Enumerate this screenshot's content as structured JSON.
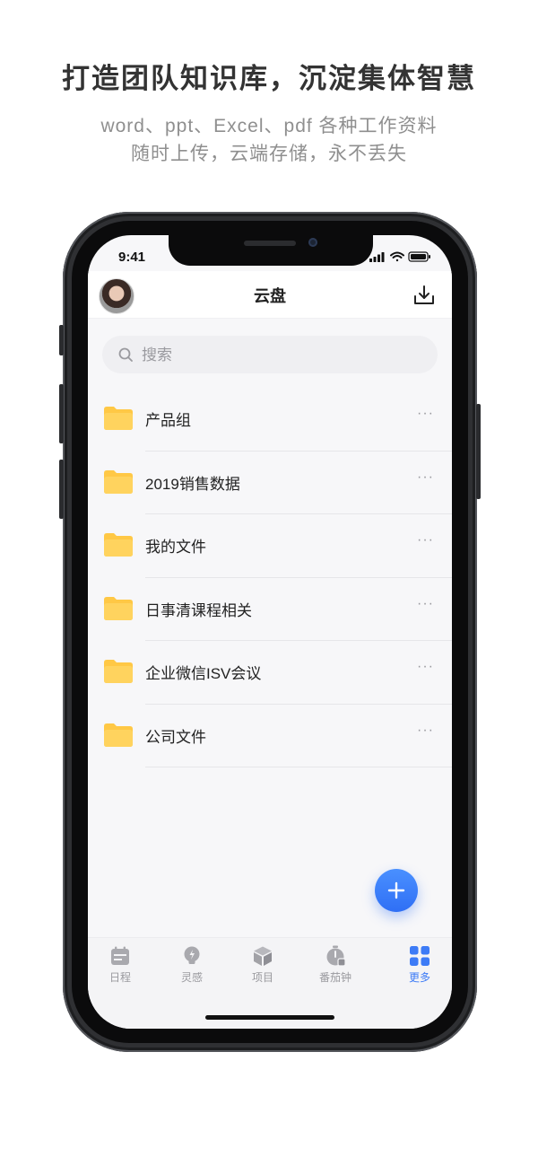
{
  "promo": {
    "headline": "打造团队知识库，沉淀集体智慧",
    "subline1": "word、ppt、Excel、pdf 各种工作资料",
    "subline2": "随时上传，云端存储，永不丢失"
  },
  "status_bar": {
    "time": "9:41"
  },
  "header": {
    "title": "云盘"
  },
  "search": {
    "placeholder": "搜索"
  },
  "folders": [
    {
      "name": "产品组",
      "more": "···"
    },
    {
      "name": "2019销售数据",
      "more": "···"
    },
    {
      "name": "我的文件",
      "more": "···"
    },
    {
      "name": "日事清课程相关",
      "more": "···"
    },
    {
      "name": "企业微信ISV会议",
      "more": "···"
    },
    {
      "name": "公司文件",
      "more": "···"
    }
  ],
  "tabs": [
    {
      "label": "日程",
      "icon": "calendar-icon"
    },
    {
      "label": "灵感",
      "icon": "lightbulb-icon"
    },
    {
      "label": "项目",
      "icon": "box-icon"
    },
    {
      "label": "番茄钟",
      "icon": "timer-icon"
    },
    {
      "label": "更多",
      "icon": "grid-icon",
      "active": true
    }
  ],
  "colors": {
    "accent": "#3d7bf6",
    "folder": "#ffc845",
    "tab_inactive": "#9a9a9f"
  }
}
